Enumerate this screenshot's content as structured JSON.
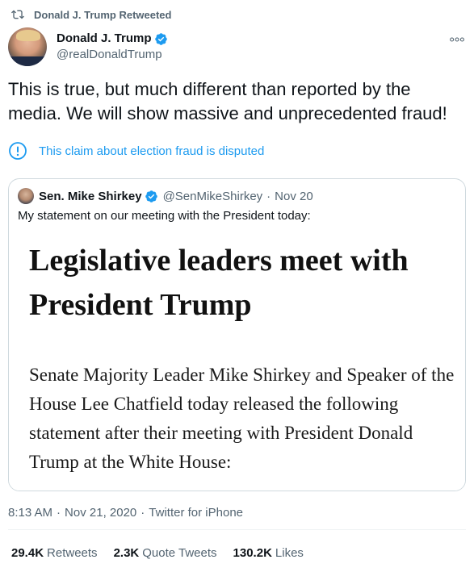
{
  "retweet_context": {
    "icon": "retweet-icon",
    "label": "Donald J. Trump Retweeted"
  },
  "author": {
    "display_name": "Donald J. Trump",
    "handle": "@realDonaldTrump",
    "verified": true
  },
  "tweet": {
    "text": "This is true, but much different than reported by the media. We will show massive and unprecedented fraud!"
  },
  "notice": {
    "icon": "exclamation-circle-icon",
    "text": "This claim about election fraud is disputed"
  },
  "quoted_tweet": {
    "display_name": "Sen. Mike Shirkey",
    "handle": "@SenMikeShirkey",
    "separator": "·",
    "date": "Nov 20",
    "text": "My statement on our meeting with the President today:",
    "image": {
      "headline": "Legislative leaders meet with President Trump",
      "body": "Senate Majority Leader Mike Shirkey and Speaker of the House Lee Chatfield today released the following statement after their meeting with President Donald Trump at the White House:"
    }
  },
  "meta": {
    "time": "8:13 AM",
    "separator": "·",
    "date": "Nov 21, 2020",
    "source": "Twitter for iPhone"
  },
  "stats": {
    "retweets": {
      "count": "29.4K",
      "label": "Retweets"
    },
    "quote_tweets": {
      "count": "2.3K",
      "label": "Quote Tweets"
    },
    "likes": {
      "count": "130.2K",
      "label": "Likes"
    }
  },
  "colors": {
    "accent": "#1d9bf0",
    "secondary_text": "#536471",
    "primary_text": "#0f1419",
    "border": "#cfd9de"
  }
}
